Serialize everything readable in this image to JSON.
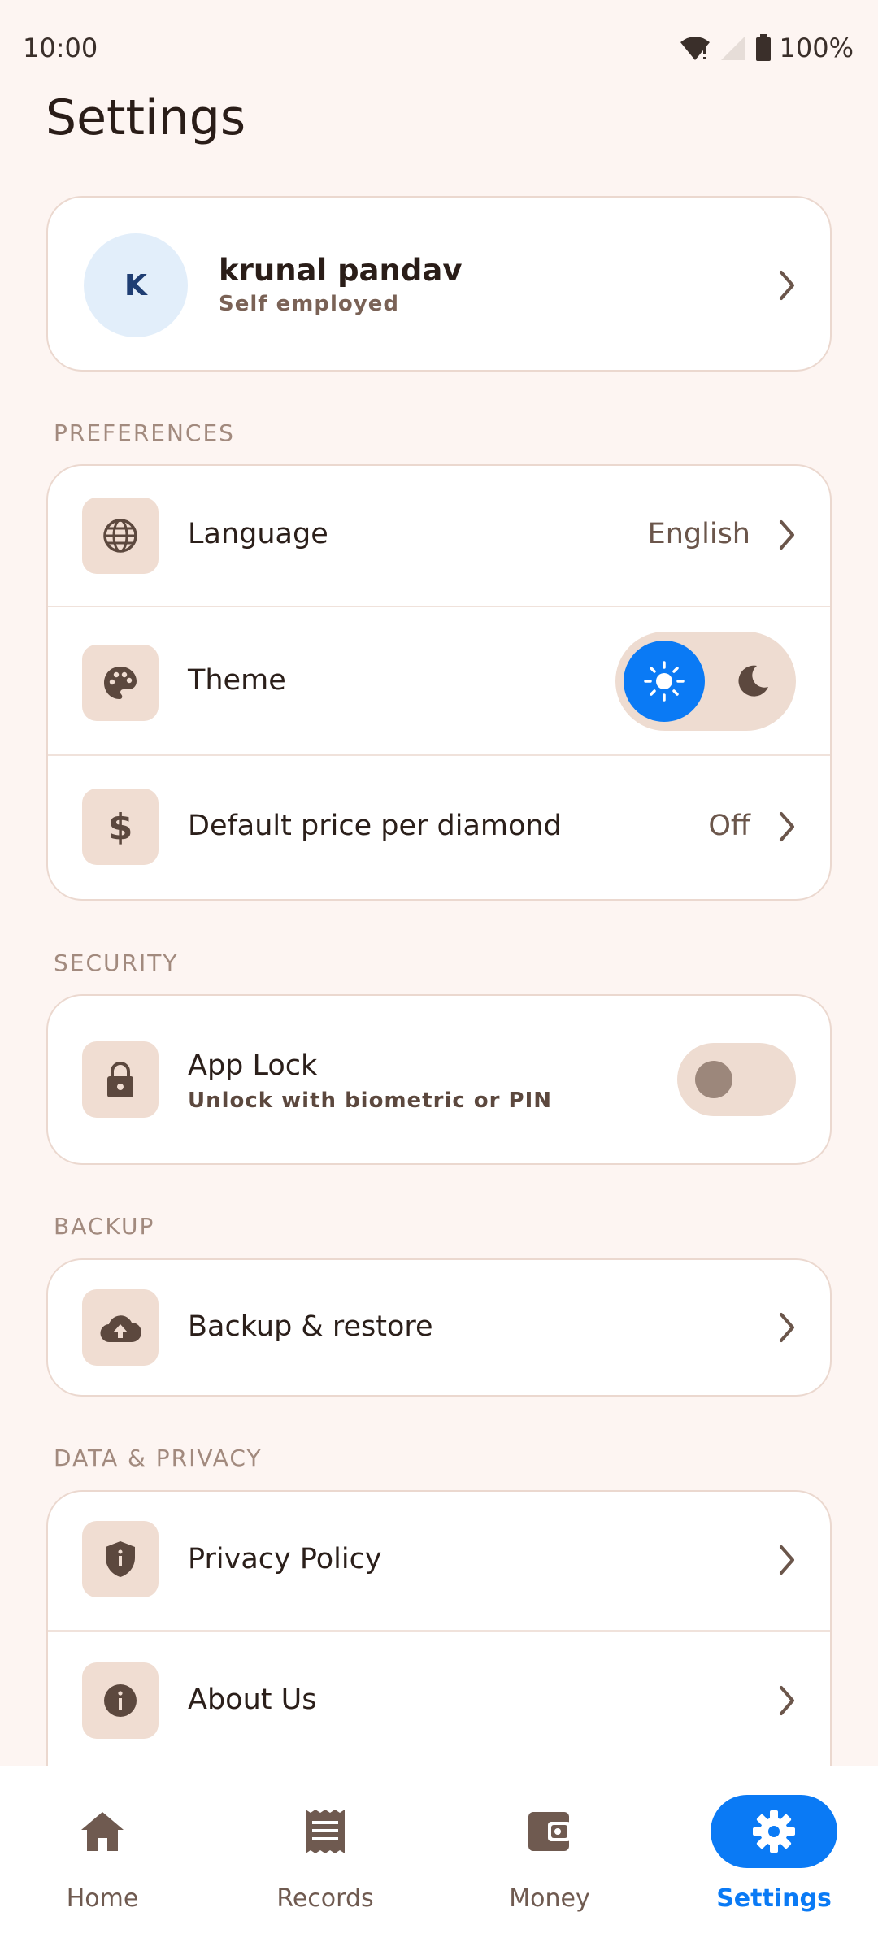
{
  "status_bar": {
    "time": "10:00",
    "battery": "100%"
  },
  "page_title": "Settings",
  "profile": {
    "initial": "K",
    "name": "krunal pandav",
    "subtitle": "Self employed"
  },
  "sections": {
    "preferences": "PREFERENCES",
    "security": "SECURITY",
    "backup": "BACKUP",
    "data_privacy": "DATA & PRIVACY"
  },
  "preferences": {
    "language": {
      "label": "Language",
      "value": "English",
      "icon": "globe-icon"
    },
    "theme": {
      "label": "Theme",
      "selected": "light",
      "icon": "palette-icon"
    },
    "price": {
      "label": "Default price per diamond",
      "value": "Off",
      "icon": "dollar-icon"
    }
  },
  "security": {
    "app_lock": {
      "label": "App Lock",
      "subtitle": "Unlock with biometric or PIN",
      "enabled": false,
      "icon": "lock-icon"
    }
  },
  "backup": {
    "backup_restore": {
      "label": "Backup & restore",
      "icon": "cloud-upload-icon"
    }
  },
  "data_privacy": {
    "privacy_policy": {
      "label": "Privacy Policy",
      "icon": "shield-icon"
    },
    "about_us": {
      "label": "About Us",
      "icon": "info-icon"
    }
  },
  "bottom_nav": {
    "items": [
      {
        "label": "Home",
        "icon": "home-icon",
        "active": false
      },
      {
        "label": "Records",
        "icon": "receipt-icon",
        "active": false
      },
      {
        "label": "Money",
        "icon": "wallet-icon",
        "active": false
      },
      {
        "label": "Settings",
        "icon": "gear-icon",
        "active": true
      }
    ]
  },
  "colors": {
    "background": "#FDF5F2",
    "accent": "#0A7AF5",
    "icon_tile": "#F0DDD2",
    "icon_fg": "#5C483E"
  }
}
